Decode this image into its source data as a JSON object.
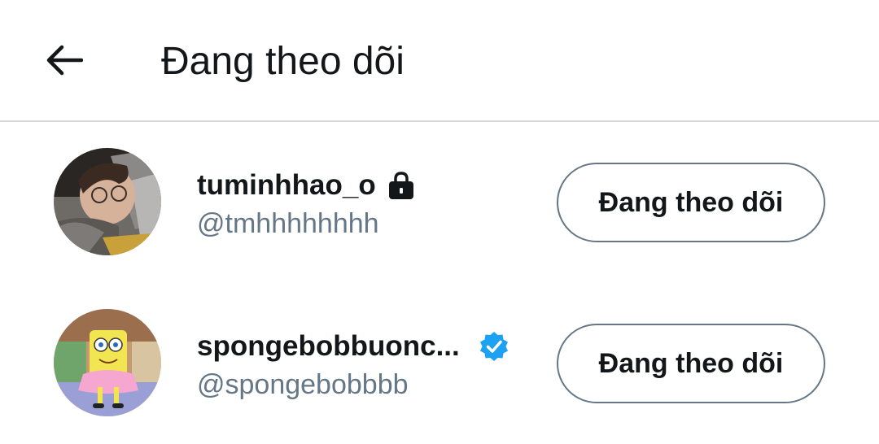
{
  "header": {
    "title": "Đang theo dõi",
    "back_icon": "arrow-left-icon"
  },
  "users": [
    {
      "name": "tuminhhao_o",
      "handle": "@tmhhhhhhhh",
      "badge": "lock-icon",
      "button_label": "Đang theo dõi"
    },
    {
      "name": "spongebobbuonc...",
      "handle": "@spongebobbbb",
      "badge": "verified-icon",
      "button_label": "Đang theo dõi"
    }
  ],
  "colors": {
    "text_primary": "#14171a",
    "text_secondary": "#657786",
    "verified": "#1da1f2",
    "divider": "#d9d9d9"
  }
}
